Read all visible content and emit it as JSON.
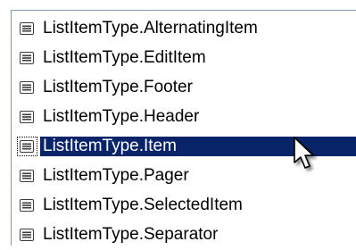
{
  "list": {
    "items": [
      {
        "label": "ListItemType.AlternatingItem",
        "icon": "enum-member-icon",
        "selected": false
      },
      {
        "label": "ListItemType.EditItem",
        "icon": "enum-member-icon",
        "selected": false
      },
      {
        "label": "ListItemType.Footer",
        "icon": "enum-member-icon",
        "selected": false
      },
      {
        "label": "ListItemType.Header",
        "icon": "enum-member-icon",
        "selected": false
      },
      {
        "label": "ListItemType.Item",
        "icon": "enum-member-icon",
        "selected": true
      },
      {
        "label": "ListItemType.Pager",
        "icon": "enum-member-icon",
        "selected": false
      },
      {
        "label": "ListItemType.SelectedItem",
        "icon": "enum-member-icon",
        "selected": false
      },
      {
        "label": "ListItemType.Separator",
        "icon": "enum-member-icon",
        "selected": false
      }
    ]
  },
  "colors": {
    "selection_background": "#0a246a",
    "selection_text": "#ffffff",
    "border": "#7f9db9"
  },
  "cursor": {
    "icon": "mouse-pointer-icon"
  }
}
